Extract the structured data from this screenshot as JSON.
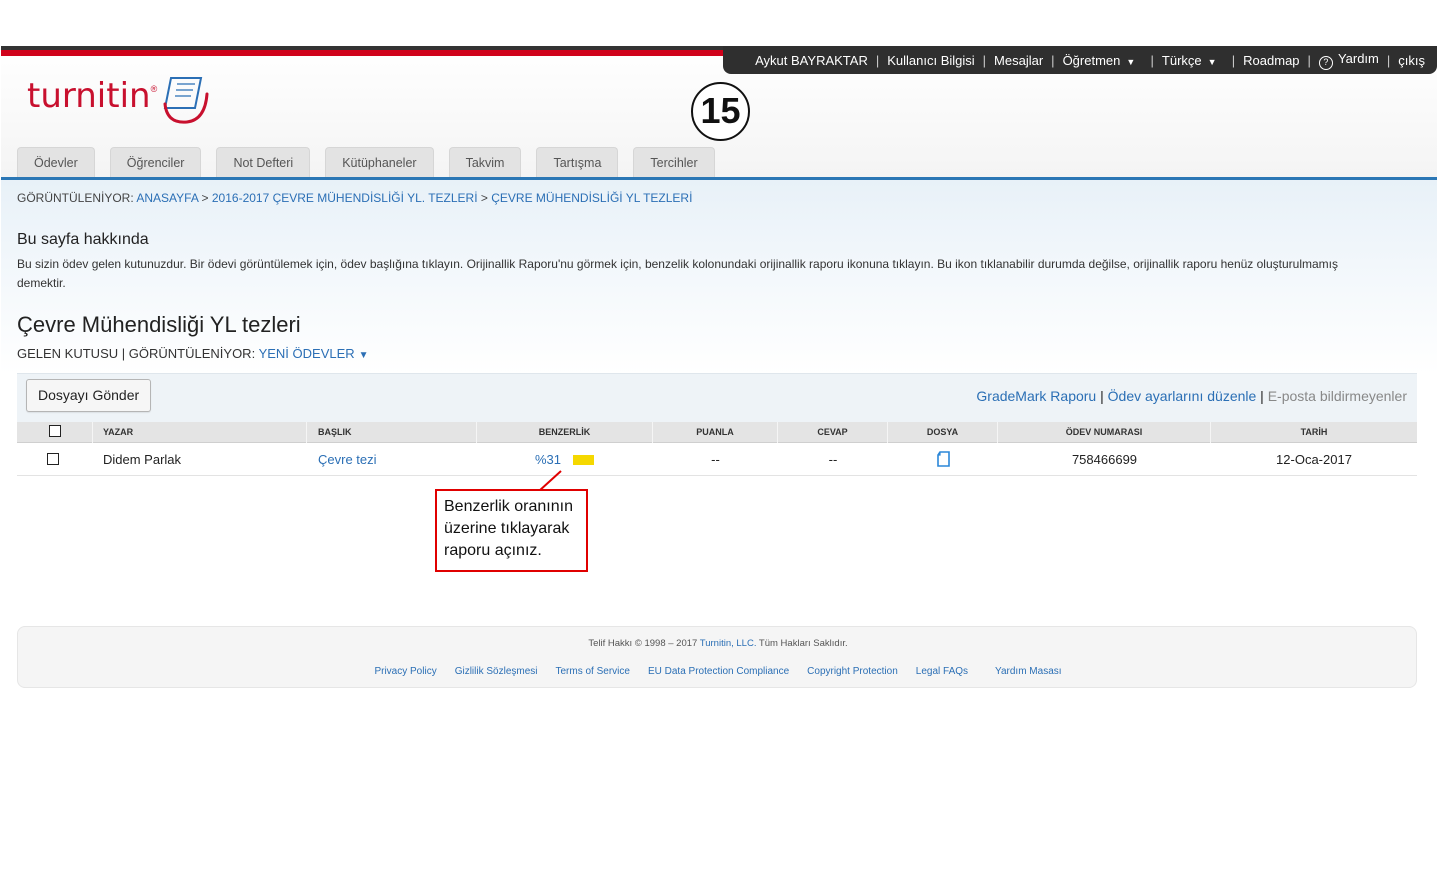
{
  "userbar": {
    "user_name": "Aykut BAYRAKTAR",
    "user_info": "Kullanıcı Bilgisi",
    "messages": "Mesajlar",
    "role": "Öğretmen",
    "language": "Türkçe",
    "roadmap": "Roadmap",
    "help": "Yardım",
    "logout": "çıkış",
    "separator": "|",
    "caret": "▼",
    "help_icon_glyph": "?"
  },
  "logo": {
    "text": "turnitin",
    "mark": "®",
    "color": "#c8102e"
  },
  "step_badge": "15",
  "tabs": [
    {
      "label": "Ödevler"
    },
    {
      "label": "Öğrenciler"
    },
    {
      "label": "Not Defteri"
    },
    {
      "label": "Kütüphaneler"
    },
    {
      "label": "Takvim"
    },
    {
      "label": "Tartışma"
    },
    {
      "label": "Tercihler"
    }
  ],
  "breadcrumb": {
    "prefix": "GÖRÜNTÜLENİYOR:",
    "home": "ANASAYFA",
    "sep": ">",
    "class": "2016-2017 ÇEVRE MÜHENDİSLİĞİ YL. TEZLERİ",
    "assignment": "ÇEVRE MÜHENDİSLİĞİ YL TEZLERİ"
  },
  "about": {
    "title": "Bu sayfa hakkında",
    "text": "Bu sizin ödev gelen kutunuzdur. Bir ödevi görüntülemek için, ödev başlığına tıklayın. Orijinallik Raporu'nu görmek için, benzelik kolonundaki orijinallik raporu ikonuna tıklayın. Bu ikon tıklanabilir durumda değilse, orijinallik raporu henüz oluşturulmamış demektir."
  },
  "page": {
    "title": "Çevre Mühendisliği YL tezleri",
    "inbox_label": "GELEN KUTUSU",
    "sep": "|",
    "viewing_label": "GÖRÜNTÜLENİYOR:",
    "viewing_value": "YENİ ÖDEVLER",
    "caret": "▼"
  },
  "toolbar": {
    "submit_label": "Dosyayı Gönder",
    "grademark_report": "GradeMark Raporu",
    "sep": "|",
    "edit_settings": "Ödev ayarlarını düzenle",
    "email_nonsubmitters": "E-posta bildirmeyenler"
  },
  "table": {
    "headers": {
      "author": "YAZAR",
      "title": "BAŞLIK",
      "similarity": "BENZERLİK",
      "grade": "PUANLA",
      "response": "CEVAP",
      "file": "DOSYA",
      "paper_id": "ÖDEV NUMARASI",
      "date": "TARİH"
    },
    "rows": [
      {
        "author": "Didem Parlak",
        "title": "Çevre tezi",
        "similarity": "%31",
        "similarity_color": "#f5d800",
        "grade": "--",
        "response": "--",
        "file_icon": "document-icon",
        "paper_id": "758466699",
        "date": "12-Oca-2017"
      }
    ]
  },
  "annotation": {
    "text_line1": "Benzerlik oranının",
    "text_line2": "üzerine tıklayarak",
    "text_line3": "raporu açınız.",
    "border_color": "#e00000"
  },
  "footer": {
    "copyright_prefix": "Telif Hakkı © 1998 – 2017",
    "copyright_link": "Turnitin, LLC.",
    "copyright_suffix": "Tüm Hakları Saklıdır.",
    "links": [
      {
        "label": "Privacy Policy"
      },
      {
        "label": "Gizlilik Sözleşmesi"
      },
      {
        "label": "Terms of Service"
      },
      {
        "label": "EU Data Protection Compliance"
      },
      {
        "label": "Copyright Protection"
      },
      {
        "label": "Legal FAQs"
      },
      {
        "label": "Yardım Masası"
      }
    ]
  },
  "colors": {
    "brand_red": "#d0021b",
    "link_blue": "#2b6fb5",
    "nav_blue_line": "#2b77b5",
    "userbar_bg": "#2f2f2f"
  }
}
